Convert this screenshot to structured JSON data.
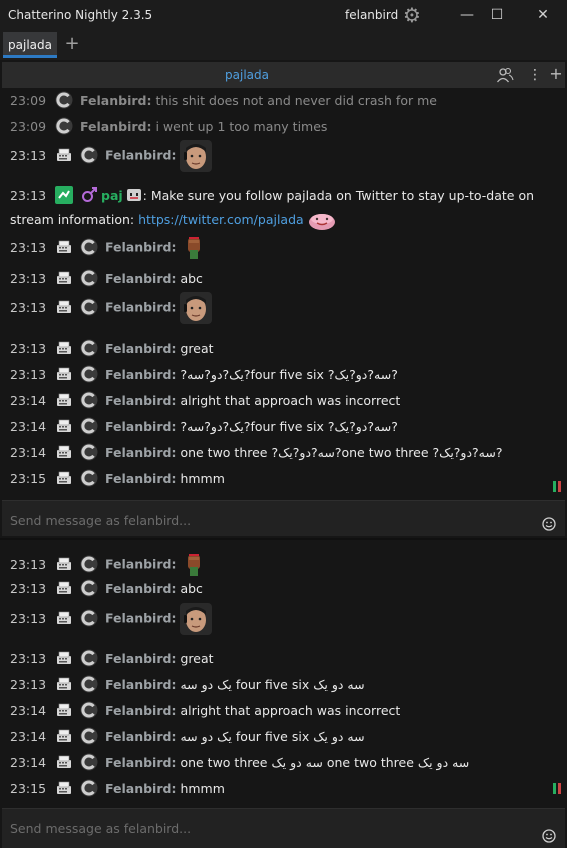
{
  "window": {
    "title": "Chatterino Nightly 2.3.5",
    "user": "felanbird",
    "minimize_glyph": "—",
    "maximize_glyph": "☐",
    "close_glyph": "✕"
  },
  "tabs": [
    {
      "label": "pajlada"
    }
  ],
  "add_tab_glyph": "+",
  "split": {
    "title": "pajlada",
    "menu_glyph": "⋮",
    "plus_glyph": "+"
  },
  "chat_top": {
    "messages": [
      {
        "time": "23:09",
        "user": "Felanbird:",
        "text": "this shit does not and never did crash for me"
      },
      {
        "time": "23:09",
        "user": "Felanbird:",
        "text": "i went up 1 too many times"
      },
      {
        "time": "23:13",
        "user": "Felanbird:",
        "emote": "face"
      },
      {
        "time": "23:13",
        "user": "paj",
        "text": ": Make sure you follow pajlada on Twitter to stay up-to-date on stream information:",
        "link": "https://twitter.com/pajlada"
      },
      {
        "time": "23:13",
        "user": "Felanbird:",
        "emote": "fist"
      },
      {
        "time": "23:13",
        "user": "Felanbird:",
        "text": "abc"
      },
      {
        "time": "23:13",
        "user": "Felanbird:",
        "emote": "face"
      },
      {
        "time": "23:13",
        "user": "Felanbird:",
        "text": "great"
      },
      {
        "time": "23:13",
        "user": "Felanbird:",
        "text": "?یک?دو?سه?four five six ?سه?دو?یک?"
      },
      {
        "time": "23:14",
        "user": "Felanbird:",
        "text": "alright that approach was incorrect"
      },
      {
        "time": "23:14",
        "user": "Felanbird:",
        "text": "?یک?دو?سه?four five six ?سه?دو?یک?"
      },
      {
        "time": "23:14",
        "user": "Felanbird:",
        "text": "one two three ?سه?دو?یک?one two three ?سه?دو?یک?"
      },
      {
        "time": "23:15",
        "user": "Felanbird:",
        "text": "hmmm"
      }
    ]
  },
  "chat_bottom": {
    "messages": [
      {
        "time": "23:13",
        "user": "Felanbird:",
        "emote": "fist"
      },
      {
        "time": "23:13",
        "user": "Felanbird:",
        "text": "abc"
      },
      {
        "time": "23:13",
        "user": "Felanbird:",
        "emote": "face"
      },
      {
        "time": "23:13",
        "user": "Felanbird:",
        "text": "great"
      },
      {
        "time": "23:13",
        "user": "Felanbird:",
        "text": "یک دو سه four five six سه دو یک"
      },
      {
        "time": "23:14",
        "user": "Felanbird:",
        "text": "alright that approach was incorrect"
      },
      {
        "time": "23:14",
        "user": "Felanbird:",
        "text": "یک دو سه four five six سه دو یک"
      },
      {
        "time": "23:14",
        "user": "Felanbird:",
        "text": "one two three سه دو یک one two three سه دو یک"
      },
      {
        "time": "23:15",
        "user": "Felanbird:",
        "text": "hmmm"
      }
    ]
  },
  "input": {
    "placeholder": "Send message as felanbird..."
  },
  "colors": {
    "accent": "#2d7ac4",
    "link": "#4f9fe0",
    "background": "#161616",
    "username": "#9da2a6",
    "mod_green": "#27ae60"
  },
  "icons": [
    "settings-gear-icon",
    "viewer-list-icon",
    "split-menu-icon",
    "add-split-icon",
    "emoji-icon",
    "chatterino-badge-icon",
    "typewriter-badge-icon",
    "moderator-badge-icon",
    "gender-badge-icon",
    "glitch-badge-icon"
  ]
}
